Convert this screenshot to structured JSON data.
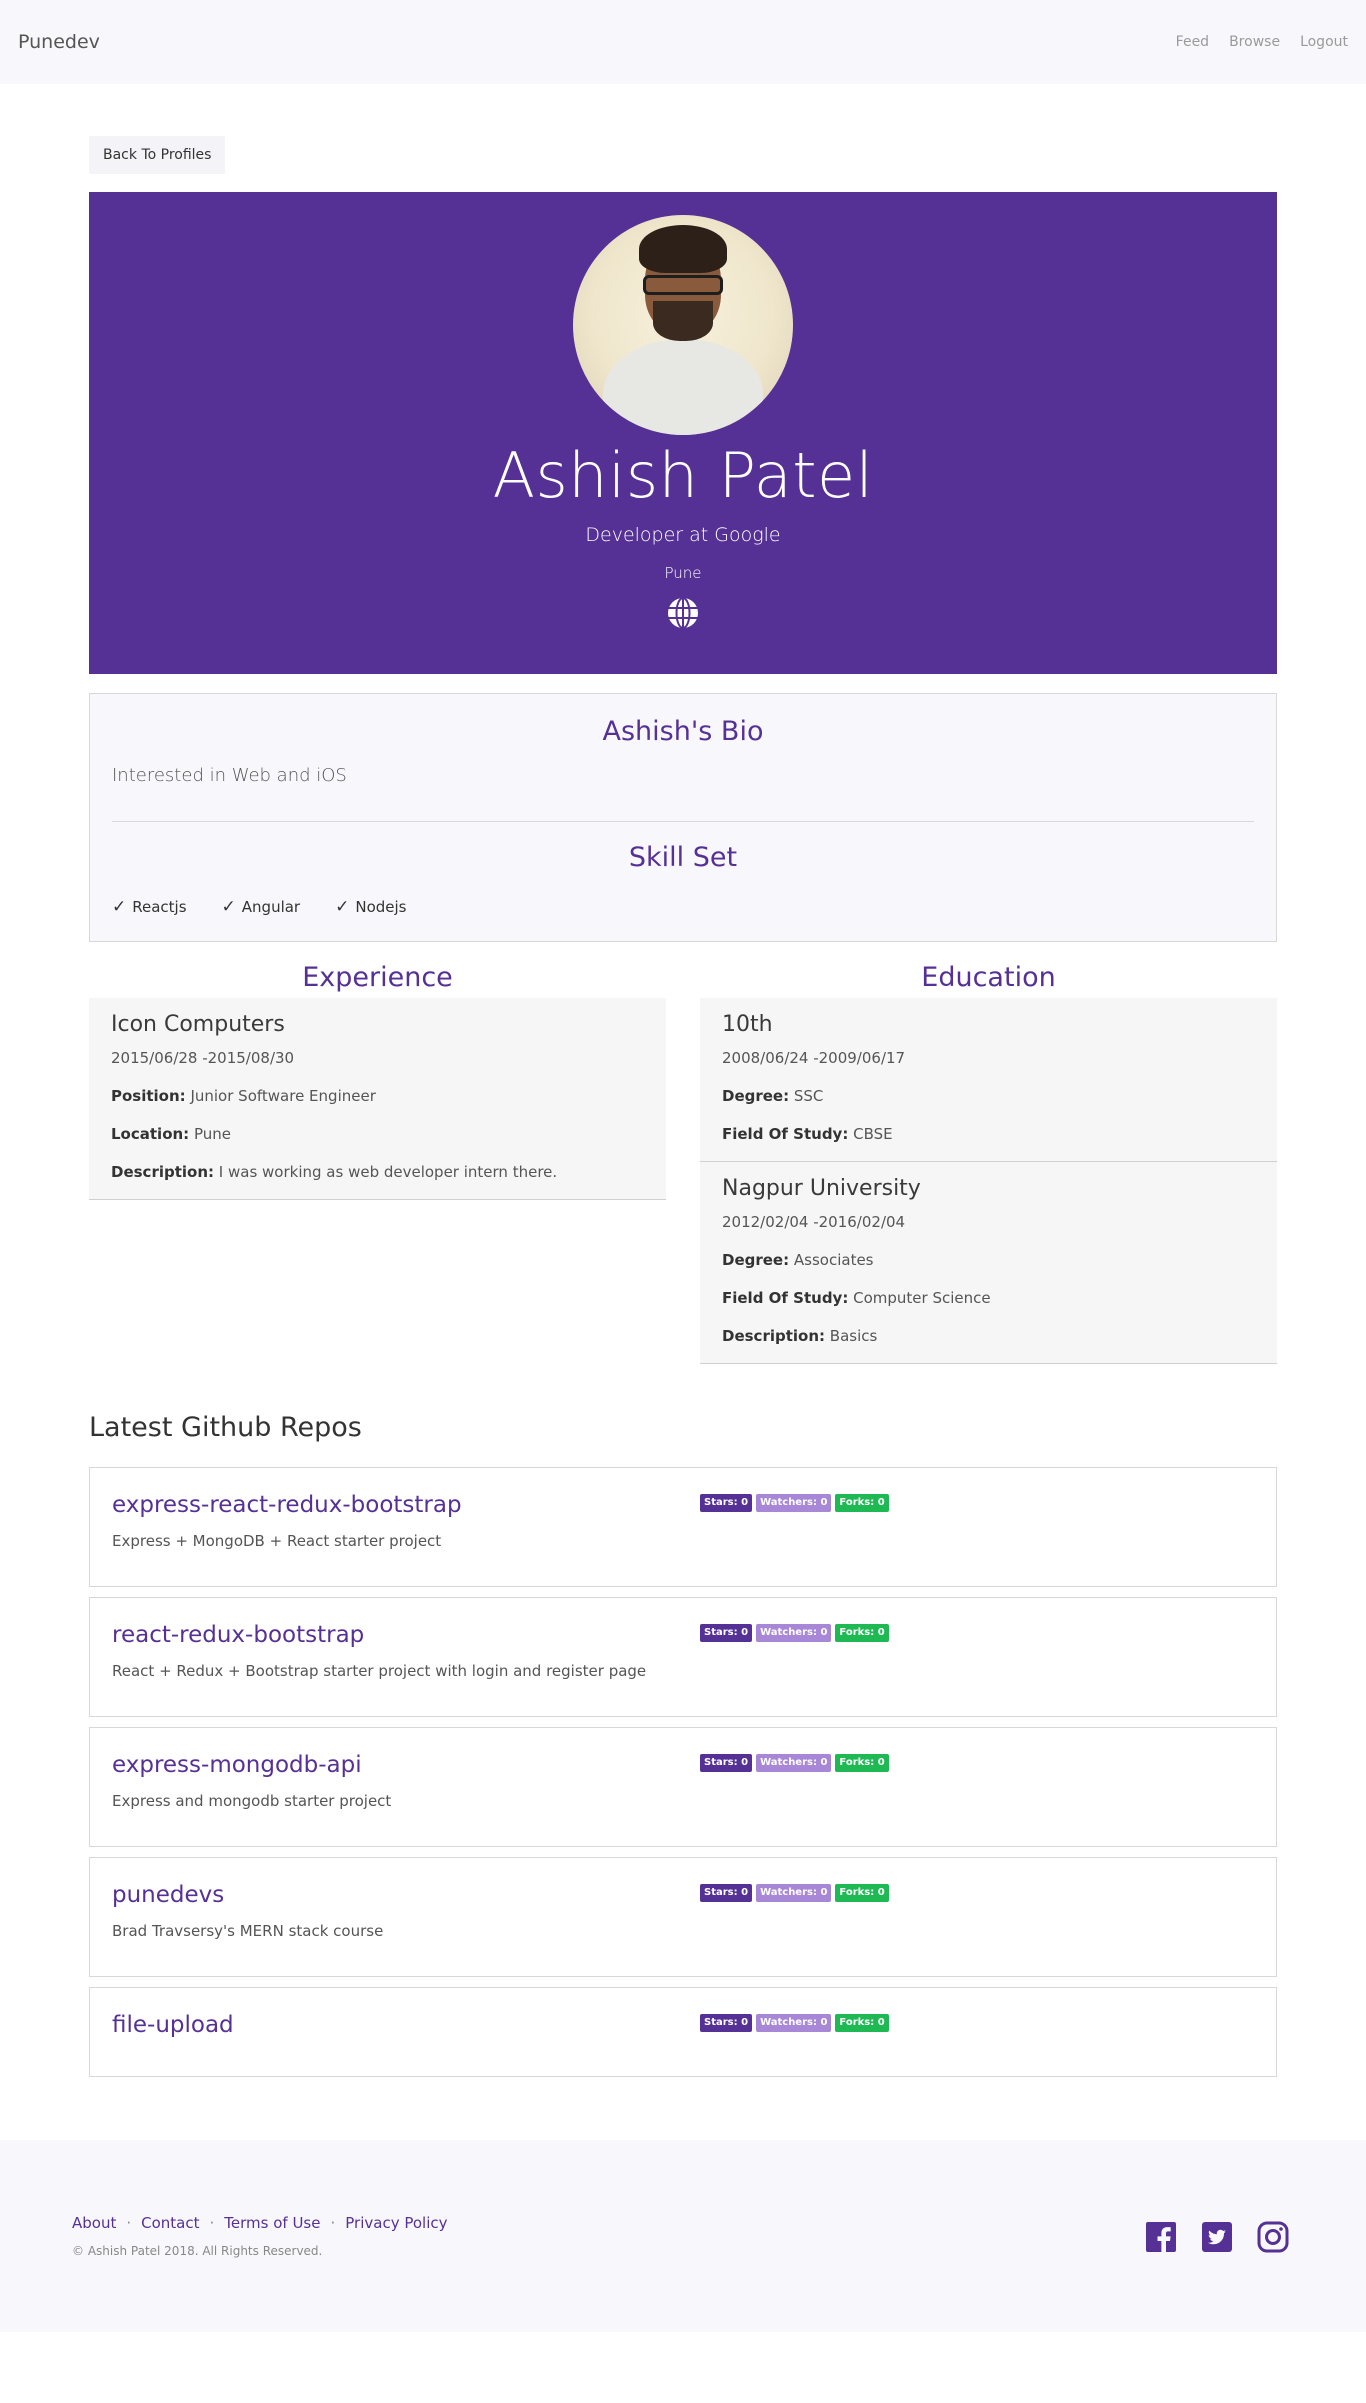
{
  "nav": {
    "brand": "Punedev",
    "links": [
      "Feed",
      "Browse",
      "Logout"
    ]
  },
  "back_button": "Back To Profiles",
  "profile": {
    "name": "Ashish Patel",
    "title": "Developer at Google",
    "location": "Pune"
  },
  "bio": {
    "heading": "Ashish's Bio",
    "text": "Interested in Web and iOS",
    "skills_heading": "Skill Set",
    "skills": [
      "Reactjs",
      "Angular",
      "Nodejs"
    ]
  },
  "experience": {
    "heading": "Experience",
    "items": [
      {
        "company": "Icon Computers",
        "dates": "2015/06/28 -2015/08/30",
        "position_label": "Position:",
        "position": "Junior Software Engineer",
        "location_label": "Location:",
        "location": "Pune",
        "description_label": "Description:",
        "description": "I was working as web developer intern there."
      }
    ]
  },
  "education": {
    "heading": "Education",
    "items": [
      {
        "school": "10th",
        "dates": "2008/06/24 -2009/06/17",
        "degree_label": "Degree:",
        "degree": "SSC",
        "field_label": "Field Of Study:",
        "field": "CBSE"
      },
      {
        "school": "Nagpur University",
        "dates": "2012/02/04 -2016/02/04",
        "degree_label": "Degree:",
        "degree": "Associates",
        "field_label": "Field Of Study:",
        "field": "Computer Science",
        "description_label": "Description:",
        "description": "Basics"
      }
    ]
  },
  "repos": {
    "heading": "Latest Github Repos",
    "items": [
      {
        "name": "express-react-redux-bootstrap",
        "description": "Express + MongoDB + React starter project",
        "stars": "Stars: 0",
        "watchers": "Watchers: 0",
        "forks": "Forks: 0"
      },
      {
        "name": "react-redux-bootstrap",
        "description": "React + Redux + Bootstrap starter project with login and register page",
        "stars": "Stars: 0",
        "watchers": "Watchers: 0",
        "forks": "Forks: 0"
      },
      {
        "name": "express-mongodb-api",
        "description": "Express and mongodb starter project",
        "stars": "Stars: 0",
        "watchers": "Watchers: 0",
        "forks": "Forks: 0"
      },
      {
        "name": "punedevs",
        "description": "Brad Travsersy's MERN stack course",
        "stars": "Stars: 0",
        "watchers": "Watchers: 0",
        "forks": "Forks: 0"
      },
      {
        "name": "file-upload",
        "description": "",
        "stars": "Stars: 0",
        "watchers": "Watchers: 0",
        "forks": "Forks: 0"
      }
    ]
  },
  "footer": {
    "links": [
      "About",
      "Contact",
      "Terms of Use",
      "Privacy Policy"
    ],
    "separator": "·",
    "copyright": "© Ashish Patel 2018. All Rights Reserved.",
    "social_icons": [
      "facebook-icon",
      "twitter-icon",
      "instagram-icon"
    ]
  },
  "colors": {
    "brand_purple": "#563195",
    "watchers_badge": "#a888d6",
    "forks_badge": "#1fb954"
  }
}
